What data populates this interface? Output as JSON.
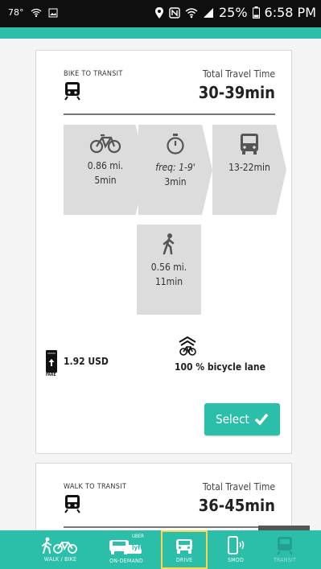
{
  "status": {
    "left_text": "78°",
    "battery": "25%",
    "time": "6:58 PM"
  },
  "cards": [
    {
      "mode": "BIKE TO TRANSIT",
      "ttt_label": "Total Travel Time",
      "ttt_value": "30-39min",
      "segments": [
        {
          "icon": "bicycle-icon",
          "line1": "0.86 mi.",
          "line2": "5min"
        },
        {
          "icon": "stopwatch-icon",
          "line1": "freq: 1-9'",
          "line2": "3min"
        },
        {
          "icon": "bus-icon",
          "line1": "13-22min",
          "line2": ""
        },
        {
          "icon": "walk-icon",
          "line1": "0.56 mi.",
          "line2": "11min"
        }
      ],
      "fare_value": "1.92 USD",
      "fare_caption": "FARE",
      "bike_lane": "100 % bicycle lane",
      "select_label": "Select"
    },
    {
      "mode": "WALK TO TRANSIT",
      "ttt_label": "Total Travel Time",
      "ttt_value": "36-45min"
    }
  ],
  "tabs": [
    {
      "label": "WALK / BIKE",
      "icon": "walk-bike-icon"
    },
    {
      "label": "ON-DEMAND",
      "icon": "car-uber-lyft-icon",
      "badge_top": "UBER",
      "badge_bottom": "lyft"
    },
    {
      "label": "DRIVE",
      "icon": "car-icon"
    },
    {
      "label": "SMOD",
      "icon": "phone-signal-icon"
    },
    {
      "label": "TRANSIT",
      "icon": "train-icon"
    }
  ],
  "colors": {
    "accent": "#2bbfa9",
    "active_tab_border": "#ffd54d"
  }
}
